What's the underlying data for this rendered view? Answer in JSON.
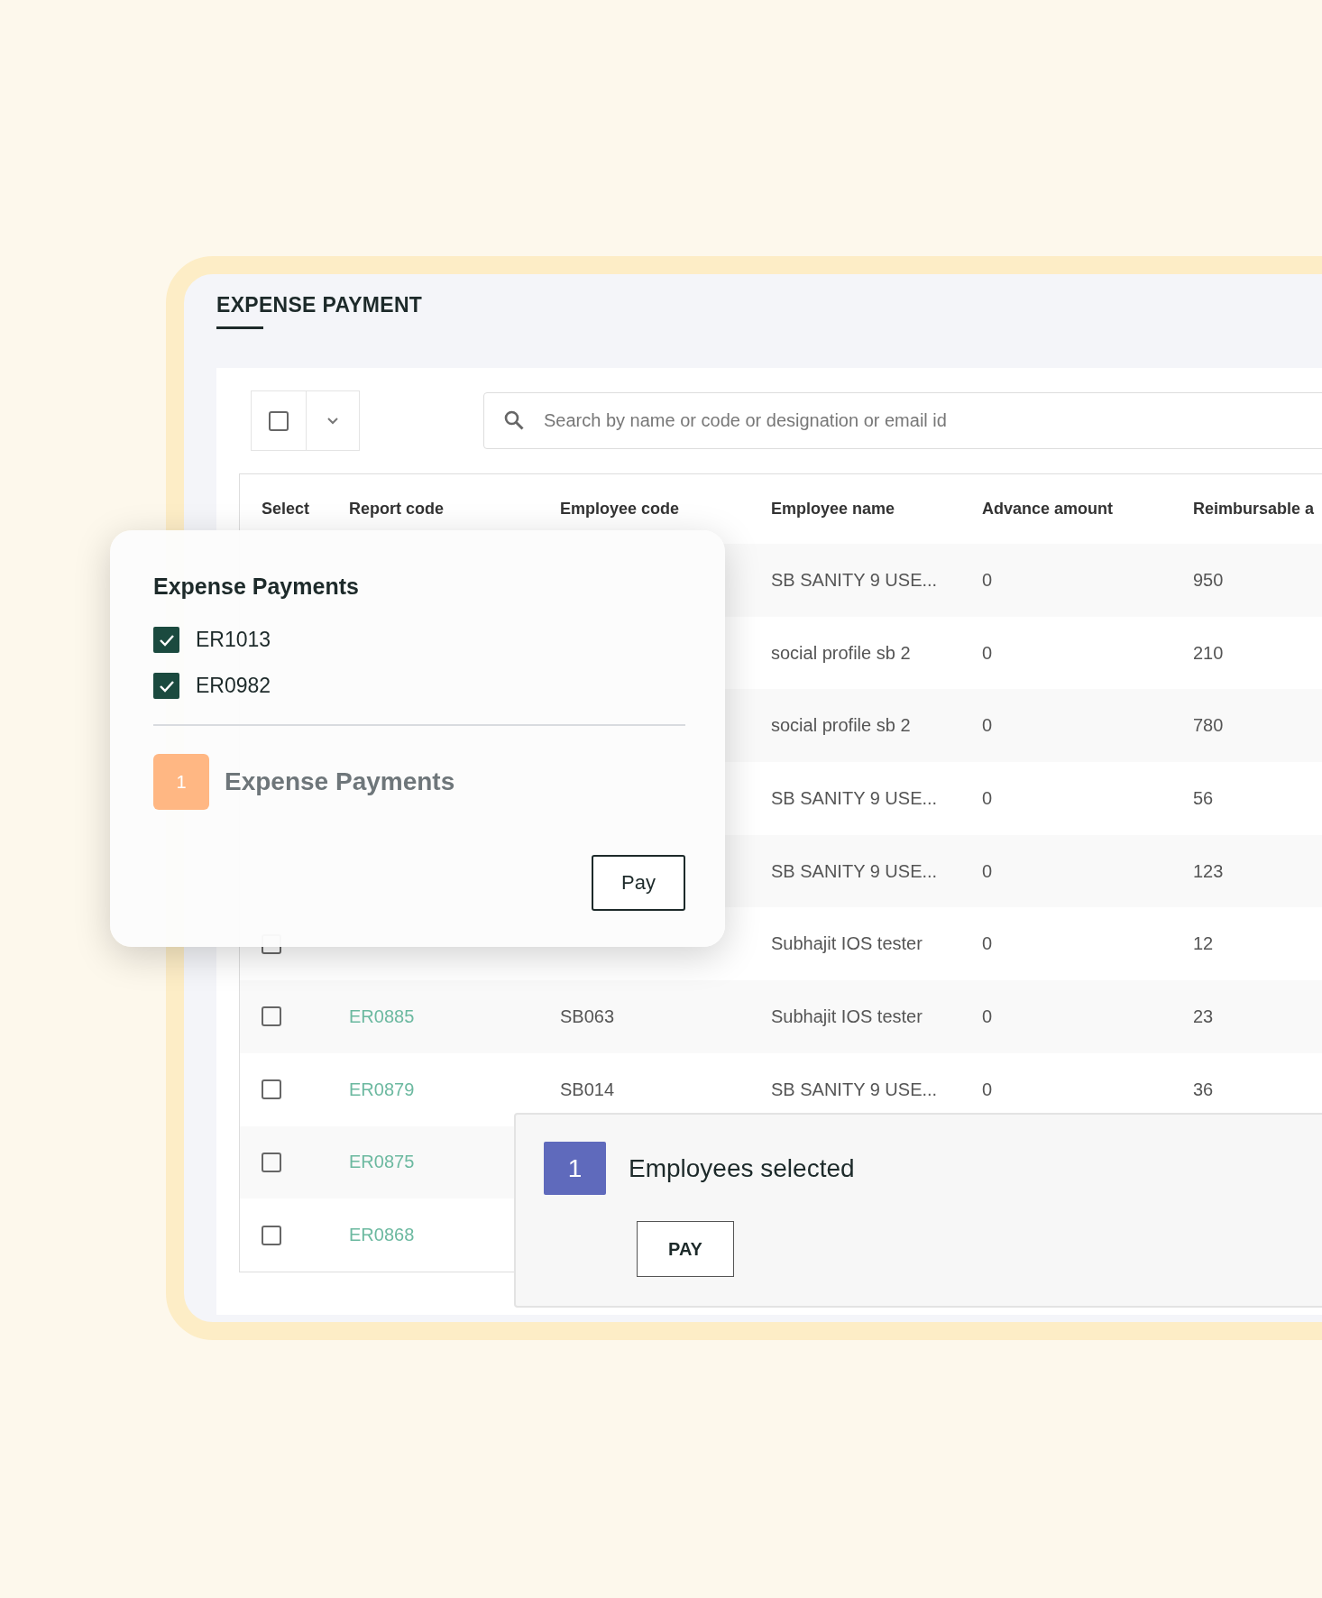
{
  "page": {
    "title": "EXPENSE PAYMENT"
  },
  "toolbar": {
    "select_all": {
      "checked": false
    },
    "search": {
      "placeholder": "Search by name or code or designation or email id"
    }
  },
  "table": {
    "columns": [
      "Select",
      "Report code",
      "Employee code",
      "Employee name",
      "Advance amount",
      "Reimbursable a"
    ],
    "rows": [
      {
        "employee_name": "SB SANITY 9 USE...",
        "advance_amount": "0",
        "reimbursable": "950"
      },
      {
        "employee_name": "social profile sb 2",
        "advance_amount": "0",
        "reimbursable": "210"
      },
      {
        "employee_name": "social profile sb 2",
        "advance_amount": "0",
        "reimbursable": "780"
      },
      {
        "employee_name": "SB SANITY 9 USE...",
        "advance_amount": "0",
        "reimbursable": "56"
      },
      {
        "employee_name": "SB SANITY 9 USE...",
        "advance_amount": "0",
        "reimbursable": "123"
      },
      {
        "checked": false,
        "employee_name": "Subhajit IOS tester",
        "advance_amount": "0",
        "reimbursable": "12"
      },
      {
        "checked": false,
        "report_code": "ER0885",
        "employee_code": "SB063",
        "employee_name": "Subhajit IOS tester",
        "advance_amount": "0",
        "reimbursable": "23"
      },
      {
        "checked": false,
        "report_code": "ER0879",
        "employee_code": "SB014",
        "employee_name": "SB SANITY 9 USE...",
        "advance_amount": "0",
        "reimbursable": "36"
      },
      {
        "checked": false,
        "report_code": "ER0875"
      },
      {
        "checked": false,
        "report_code": "ER0868"
      }
    ]
  },
  "popover": {
    "title": "Expense Payments",
    "items": [
      {
        "label": "ER1013",
        "checked": true
      },
      {
        "label": "ER0982",
        "checked": true
      }
    ],
    "count": "1",
    "count_label": "Expense Payments",
    "button": "Pay"
  },
  "selection_bar": {
    "count": "1",
    "label": "Employees selected",
    "button": "PAY"
  }
}
